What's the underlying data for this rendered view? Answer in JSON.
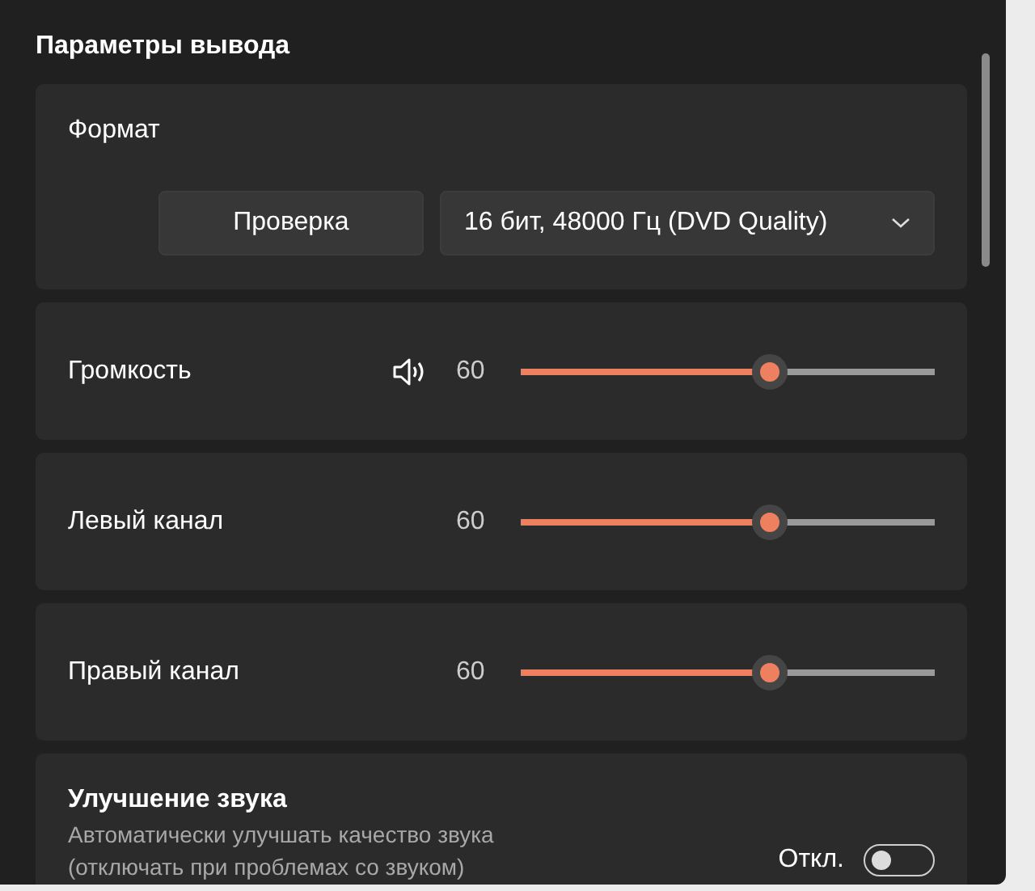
{
  "section_title": "Параметры вывода",
  "format": {
    "label": "Формат",
    "test_button": "Проверка",
    "dropdown": {
      "value": "16 бит, 48000 Гц (DVD Quality)"
    }
  },
  "sliders": [
    {
      "kind": "volume",
      "label": "Громкость",
      "reading": "60",
      "level": 0.6
    },
    {
      "kind": "plain",
      "label": "Левый канал",
      "reading": "60",
      "level": 0.6
    },
    {
      "kind": "plain",
      "label": "Правый канал",
      "reading": "60",
      "level": 0.6
    }
  ],
  "enhancement": {
    "title": "Улучшение звука",
    "description": "Автоматически улучшать качество звука (отключать при проблемах со звуком)",
    "toggle_label": "Откл.",
    "on": false
  }
}
